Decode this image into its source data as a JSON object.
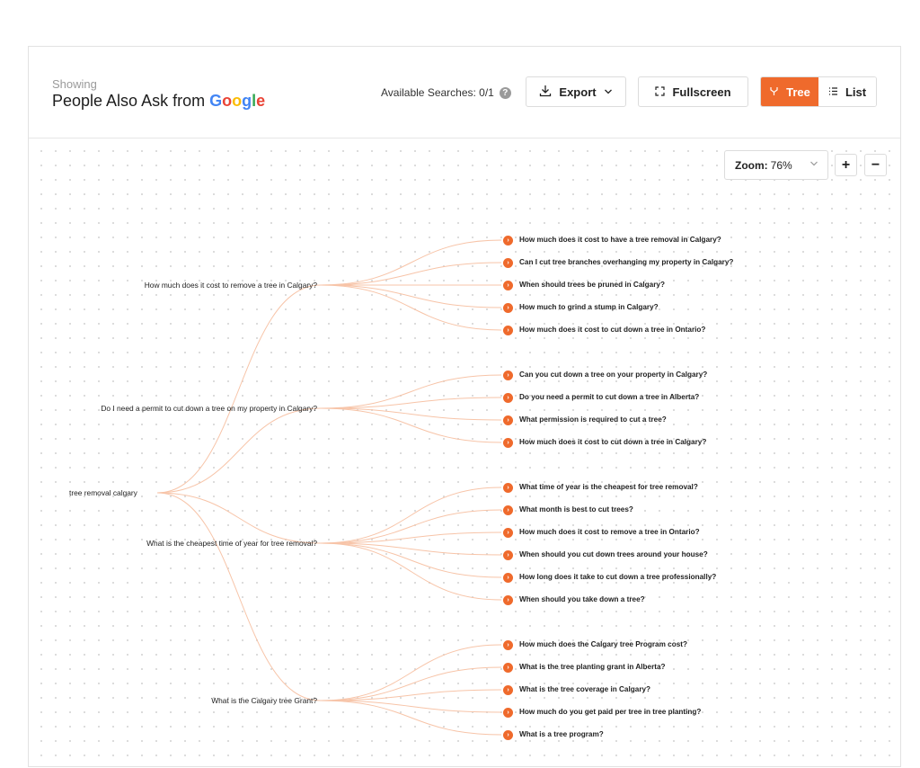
{
  "header": {
    "showing_label": "Showing",
    "title_prefix": "People Also Ask from",
    "google_letters": [
      "G",
      "o",
      "o",
      "g",
      "l",
      "e"
    ],
    "available_searches": "Available Searches: 0/1",
    "help_glyph": "?",
    "export_label": "Export",
    "fullscreen_label": "Fullscreen",
    "tree_label": "Tree",
    "list_label": "List"
  },
  "zoom": {
    "label": "Zoom:",
    "value": "76%",
    "zoom_in": "+",
    "zoom_out": "−"
  },
  "icons": {
    "export": "download-icon",
    "chevron": "chevron-down-icon",
    "fullscreen": "expand-icon",
    "tree": "tree-icon",
    "list": "list-icon",
    "help": "help-icon",
    "bullet": "arrow-circle-icon"
  },
  "colors": {
    "accent": "#ef6a2c",
    "link": "#f7c4a8",
    "google": [
      "#4285F4",
      "#EA4335",
      "#FBBC05",
      "#4285F4",
      "#34A853",
      "#EA4335"
    ]
  },
  "tree": {
    "root": "tree removal calgary",
    "branches": [
      {
        "question": "How much does it cost to remove a tree in Calgary?",
        "children": [
          "How much does it cost to have a tree removal in Calgary?",
          "Can I cut tree branches overhanging my property in Calgary?",
          "When should trees be pruned in Calgary?",
          "How much to grind a stump in Calgary?",
          "How much does it cost to cut down a tree in Ontario?"
        ]
      },
      {
        "question": "Do I need a permit to cut down a tree on my property in Calgary?",
        "children": [
          "Can you cut down a tree on your property in Calgary?",
          "Do you need a permit to cut down a tree in Alberta?",
          "What permission is required to cut a tree?",
          "How much does it cost to cut down a tree in Calgary?"
        ]
      },
      {
        "question": "What is the cheapest time of year for tree removal?",
        "children": [
          "What time of year is the cheapest for tree removal?",
          "What month is best to cut trees?",
          "How much does it cost to remove a tree in Ontario?",
          "When should you cut down trees around your house?",
          "How long does it take to cut down a tree professionally?",
          "When should you take down a tree?"
        ]
      },
      {
        "question": "What is the Calgary tree Grant?",
        "children": [
          "How much does the Calgary tree Program cost?",
          "What is the tree planting grant in Alberta?",
          "What is the tree coverage in Calgary?",
          "How much do you get paid per tree in tree planting?",
          "What is a tree program?"
        ]
      }
    ]
  }
}
